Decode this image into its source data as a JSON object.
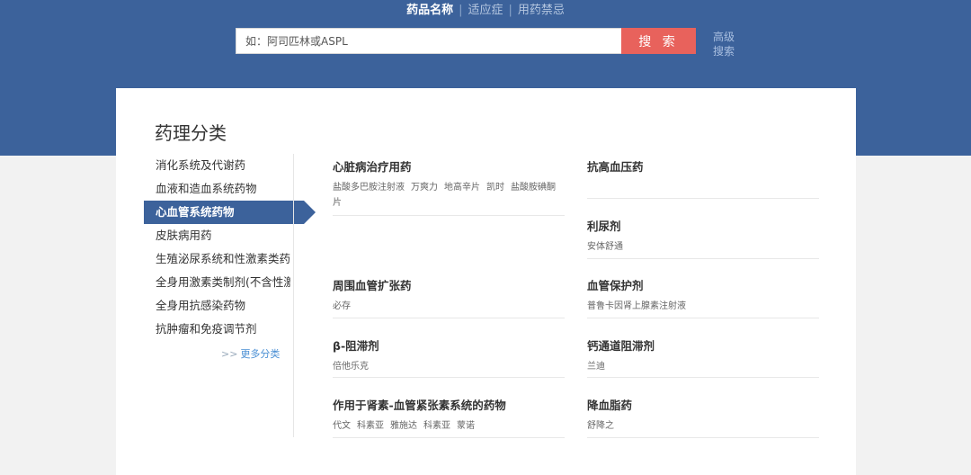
{
  "search": {
    "tabs": [
      "药品名称",
      "适应症",
      "用药禁忌"
    ],
    "placeholder": "如：阿司匹林或ASPL",
    "button_label": "搜 索",
    "advanced_label": "高级搜索"
  },
  "panel": {
    "title": "药理分类",
    "categories": [
      "消化系统及代谢药",
      "血液和造血系统药物",
      "心血管系统药物",
      "皮肤病用药",
      "生殖泌尿系统和性激素类药",
      "全身用激素类制剂(不含性激",
      "全身用抗感染药物",
      "抗肿瘤和免疫调节剂"
    ],
    "active_category": 2,
    "more_label": "更多分类"
  },
  "drug_groups": [
    {
      "title": "心脏病治疗用药",
      "items": [
        "盐酸多巴胺注射液",
        "万爽力",
        "地高辛片",
        "凯时",
        "盐酸胺碘酮片"
      ]
    },
    {
      "title": "抗高血压药",
      "items": []
    },
    {
      "title": "利尿剂",
      "items": [
        "安体舒通"
      ]
    },
    {
      "title": "周围血管扩张药",
      "items": [
        "必存"
      ]
    },
    {
      "title": "血管保护剂",
      "items": [
        "普鲁卡因肾上腺素注射液"
      ]
    },
    {
      "title": "β-阻滞剂",
      "items": [
        "倍他乐克"
      ]
    },
    {
      "title": "钙通道阻滞剂",
      "items": [
        "兰迪"
      ]
    },
    {
      "title": "作用于肾素-血管紧张素系统的药物",
      "items": [
        "代文",
        "科素亚",
        "雅施达",
        "科素亚",
        "蒙诺"
      ]
    },
    {
      "title": "降血脂药",
      "items": [
        "舒降之"
      ]
    }
  ]
}
